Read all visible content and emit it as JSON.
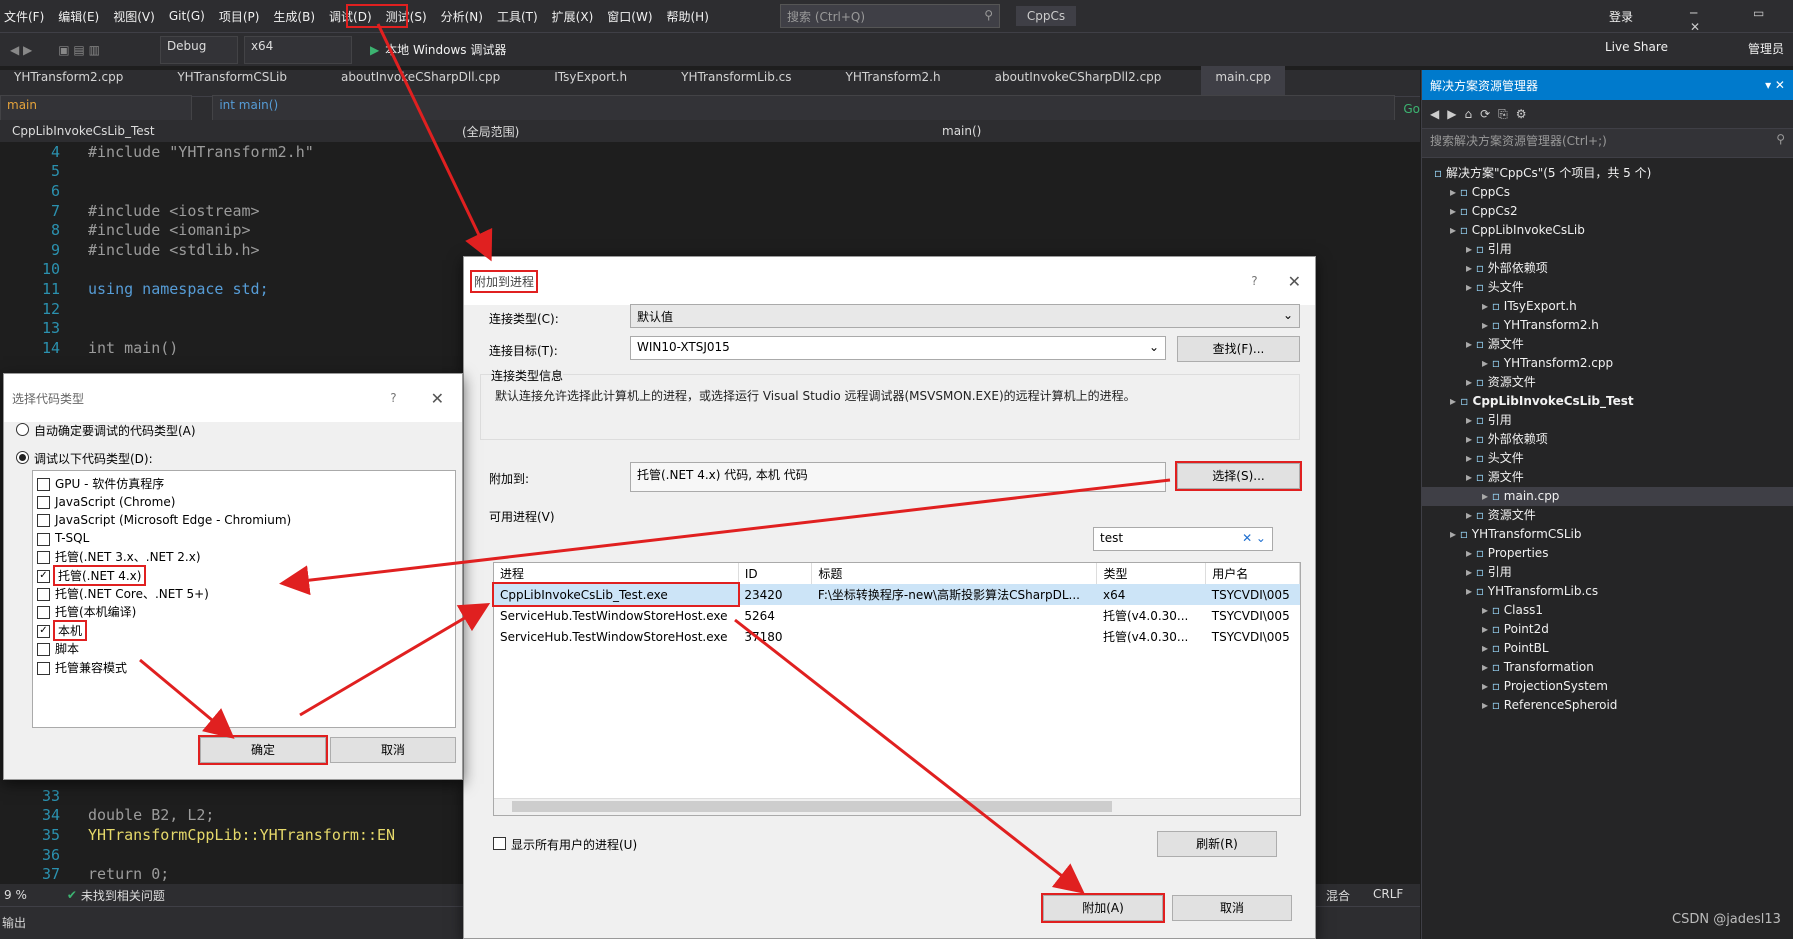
{
  "menu": [
    "文件(F)",
    "编辑(E)",
    "视图(V)",
    "Git(G)",
    "项目(P)",
    "生成(B)",
    "调试(D)",
    "测试(S)",
    "分析(N)",
    "工具(T)",
    "扩展(X)",
    "窗口(W)",
    "帮助(H)"
  ],
  "search_placeholder": "搜索 (Ctrl+Q)",
  "solution_badge": "CppCs",
  "login": "登录",
  "live_share": "Live Share",
  "admin": "管理员",
  "toolbar": {
    "config": "Debug",
    "platform": "x64",
    "run": "本地 Windows 调试器",
    "go": "Go"
  },
  "tabs": [
    "YHTransform2.cpp",
    "YHTransformCSLib",
    "aboutInvokeCSharpDll.cpp",
    "ITsyExport.h",
    "YHTransformLib.cs",
    "YHTransform2.h",
    "aboutInvokeCSharpDll2.cpp",
    "main.cpp"
  ],
  "nav": {
    "left": "main",
    "right": "int main()",
    "project": "CppLibInvokeCsLib_Test",
    "scope": "(全局范围)",
    "member": "main()"
  },
  "code_lines": [
    {
      "n": "4",
      "t": "#include \"YHTransform2.h\""
    },
    {
      "n": "5",
      "t": ""
    },
    {
      "n": "6",
      "t": ""
    },
    {
      "n": "7",
      "t": "#include <iostream>"
    },
    {
      "n": "8",
      "t": "#include <iomanip>"
    },
    {
      "n": "9",
      "t": "#include <stdlib.h>"
    },
    {
      "n": "10",
      "t": ""
    },
    {
      "n": "11",
      "t": "using namespace std;"
    },
    {
      "n": "12",
      "t": ""
    },
    {
      "n": "13",
      "t": ""
    },
    {
      "n": "14",
      "t": "int main()"
    }
  ],
  "code_lines_bottom": [
    {
      "n": "33",
      "t": ""
    },
    {
      "n": "34",
      "t": "double B2, L2;"
    },
    {
      "n": "35",
      "t": "YHTransformCppLib::YHTransform::EN"
    },
    {
      "n": "36",
      "t": ""
    },
    {
      "n": "37",
      "t": "return 0;"
    }
  ],
  "status": {
    "zoom": "9 %",
    "issues": "未找到相关问题",
    "mixed": "混合",
    "crlf": "CRLF",
    "output": "输出"
  },
  "solution_explorer": {
    "title": "解决方案资源管理器",
    "search": "搜索解决方案资源管理器(Ctrl+;)",
    "items": [
      {
        "label": "解决方案\"CppCs\"(5 个项目，共 5 个)",
        "depth": 0,
        "bold": false
      },
      {
        "label": "CppCs",
        "depth": 1
      },
      {
        "label": "CppCs2",
        "depth": 1
      },
      {
        "label": "CppLibInvokeCsLib",
        "depth": 1
      },
      {
        "label": "引用",
        "depth": 2
      },
      {
        "label": "外部依赖项",
        "depth": 2
      },
      {
        "label": "头文件",
        "depth": 2
      },
      {
        "label": "ITsyExport.h",
        "depth": 3
      },
      {
        "label": "YHTransform2.h",
        "depth": 3
      },
      {
        "label": "源文件",
        "depth": 2
      },
      {
        "label": "YHTransform2.cpp",
        "depth": 3
      },
      {
        "label": "资源文件",
        "depth": 2
      },
      {
        "label": "CppLibInvokeCsLib_Test",
        "depth": 1,
        "bold": true
      },
      {
        "label": "引用",
        "depth": 2
      },
      {
        "label": "外部依赖项",
        "depth": 2
      },
      {
        "label": "头文件",
        "depth": 2
      },
      {
        "label": "源文件",
        "depth": 2
      },
      {
        "label": "main.cpp",
        "depth": 3,
        "selected": true
      },
      {
        "label": "资源文件",
        "depth": 2
      },
      {
        "label": "YHTransformCSLib",
        "depth": 1
      },
      {
        "label": "Properties",
        "depth": 2
      },
      {
        "label": "引用",
        "depth": 2
      },
      {
        "label": "YHTransformLib.cs",
        "depth": 2
      },
      {
        "label": "Class1",
        "depth": 3
      },
      {
        "label": "Point2d",
        "depth": 3
      },
      {
        "label": "PointBL",
        "depth": 3
      },
      {
        "label": "Transformation",
        "depth": 3
      },
      {
        "label": "ProjectionSystem",
        "depth": 3
      },
      {
        "label": "ReferenceSpheroid",
        "depth": 3
      }
    ]
  },
  "attach_dialog": {
    "title": "附加到进程",
    "conn_type_label": "连接类型(C):",
    "conn_type_value": "默认值",
    "conn_target_label": "连接目标(T):",
    "conn_target_value": "WIN10-XTSJ015",
    "find_button": "查找(F)...",
    "info_group": "连接类型信息",
    "info_text": "默认连接允许选择此计算机上的进程，或选择运行 Visual Studio 远程调试器(MSVSMON.EXE)的远程计算机上的进程。",
    "attach_to_label": "附加到:",
    "attach_to_value": "托管(.NET 4.x) 代码, 本机 代码",
    "select_button": "选择(S)...",
    "available_label": "可用进程(V)",
    "filter_value": "test",
    "columns": [
      "进程",
      "ID",
      "标题",
      "类型",
      "用户名"
    ],
    "rows": [
      [
        "CppLibInvokeCsLib_Test.exe",
        "23420",
        "F:\\坐标转换程序-new\\高斯投影算法CSharpDL...",
        "x64",
        "TSYCVDI\\005"
      ],
      [
        "ServiceHub.TestWindowStoreHost.exe",
        "5264",
        "",
        "托管(v4.0.30...",
        "TSYCVDI\\005"
      ],
      [
        "ServiceHub.TestWindowStoreHost.exe",
        "37180",
        "",
        "托管(v4.0.30...",
        "TSYCVDI\\005"
      ]
    ],
    "show_all_users": "显示所有用户的进程(U)",
    "refresh_button": "刷新(R)",
    "attach_button": "附加(A)",
    "cancel_button": "取消"
  },
  "code_type_dialog": {
    "title": "选择代码类型",
    "auto_option": "自动确定要调试的代码类型(A)",
    "manual_option": "调试以下代码类型(D):",
    "items": [
      {
        "label": "GPU - 软件仿真程序",
        "checked": false
      },
      {
        "label": "JavaScript (Chrome)",
        "checked": false
      },
      {
        "label": "JavaScript (Microsoft Edge - Chromium)",
        "checked": false
      },
      {
        "label": "T-SQL",
        "checked": false
      },
      {
        "label": "托管(.NET 3.x、.NET 2.x)",
        "checked": false
      },
      {
        "label": "托管(.NET 4.x)",
        "checked": true
      },
      {
        "label": "托管(.NET Core、.NET 5+)",
        "checked": false
      },
      {
        "label": "托管(本机编译)",
        "checked": false
      },
      {
        "label": "本机",
        "checked": true
      },
      {
        "label": "脚本",
        "checked": false
      },
      {
        "label": "托管兼容模式",
        "checked": false
      }
    ],
    "ok_button": "确定",
    "cancel_button": "取消"
  },
  "watermark": "CSDN @jadesl13",
  "colors": {
    "accent": "#007acc",
    "annotation": "#e02020"
  }
}
